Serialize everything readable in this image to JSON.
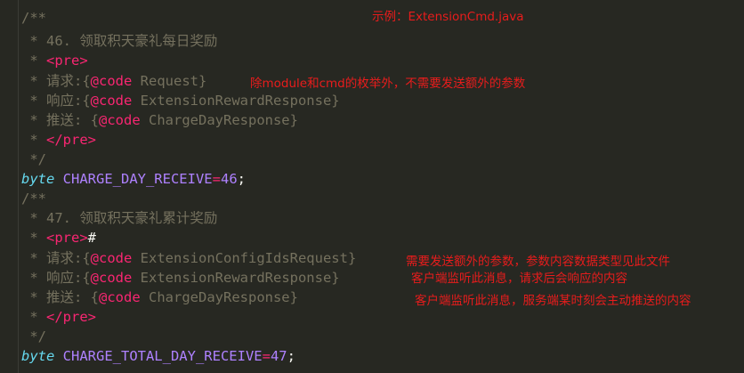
{
  "annotations": {
    "example": "示例：ExtensionCmd.java",
    "note1": "除module和cmd的枚举外，不需要发送额外的参数",
    "note2": "需要发送额外的参数，参数内容数据类型见此文件",
    "note3": "客户端监听此消息，请求后会响应的内容",
    "note4": "客户端监听此消息，服务端某时刻会主动推送的内容"
  },
  "block1": {
    "open": "/**",
    "title": " * 46. 领取积天豪礼每日奖励",
    "pre_prefix": " * ",
    "pre_open": "<pre>",
    "req_prefix": " * 请求:{",
    "req_at": "@code",
    "req_name": " Request}",
    "resp_prefix": " * 响应:{",
    "resp_at": "@code",
    "resp_name": " ExtensionRewardResponse}",
    "push_prefix": " * 推送: {",
    "push_at": "@code",
    "push_name": " ChargeDayResponse}",
    "pre_close_prefix": " * ",
    "pre_close": "</pre>",
    "close": " */",
    "type": "byte",
    "const": " CHARGE_DAY_RECEIVE",
    "eq": "=",
    "value": "46",
    "semi": ";"
  },
  "block2": {
    "open": "/**",
    "title": " * 47. 领取积天豪礼累计奖励",
    "pre_prefix": " * ",
    "pre_open": "<pre>",
    "pre_hash": "#",
    "req_prefix": " * 请求:{",
    "req_at": "@code",
    "req_name": " ExtensionConfigIdsRequest}",
    "resp_prefix": " * 响应:{",
    "resp_at": "@code",
    "resp_name": " ExtensionRewardResponse}",
    "push_prefix": " * 推送: {",
    "push_at": "@code",
    "push_name": " ChargeDayResponse}",
    "pre_close_prefix": " * ",
    "pre_close": "</pre>",
    "close": " */",
    "type": "byte",
    "const": " CHARGE_TOTAL_DAY_RECEIVE",
    "eq": "=",
    "value": "47",
    "semi": ";"
  }
}
